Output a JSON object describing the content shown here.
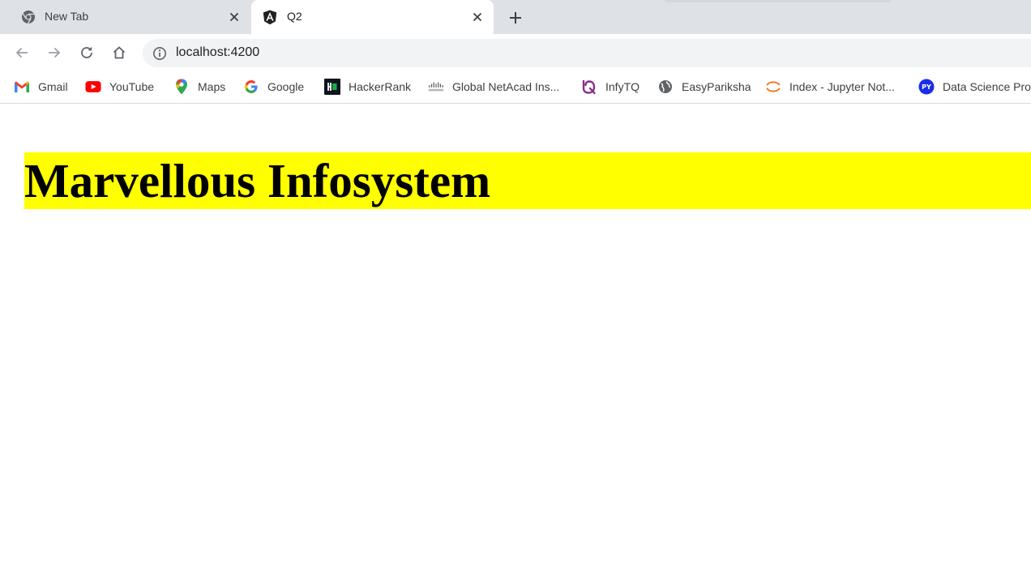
{
  "browser": {
    "tabs": [
      {
        "title": "New Tab",
        "icon": "chrome-icon",
        "active": false
      },
      {
        "title": "Q2",
        "icon": "angular-icon",
        "active": true
      }
    ],
    "address": {
      "url": "localhost:4200"
    },
    "bookmarks": [
      {
        "label": "Gmail",
        "icon": "gmail-icon"
      },
      {
        "label": "YouTube",
        "icon": "youtube-icon"
      },
      {
        "label": "Maps",
        "icon": "maps-icon"
      },
      {
        "label": "Google",
        "icon": "google-icon"
      },
      {
        "label": "HackerRank",
        "icon": "hackerrank-icon"
      },
      {
        "label": "Global NetAcad Ins...",
        "icon": "cisco-icon"
      },
      {
        "label": "InfyTQ",
        "icon": "infytq-icon"
      },
      {
        "label": "EasyPariksha",
        "icon": "globe-icon"
      },
      {
        "label": "Index - Jupyter Not...",
        "icon": "jupyter-icon"
      },
      {
        "label": "Data Science Pro",
        "icon": "py-icon"
      }
    ]
  },
  "page": {
    "heading": "Marvellous Infosystem",
    "heading_background": "#ffff00",
    "heading_color": "#000000"
  },
  "colors": {
    "tabstrip": "#dee1e6",
    "omnibox": "#f1f3f4"
  }
}
